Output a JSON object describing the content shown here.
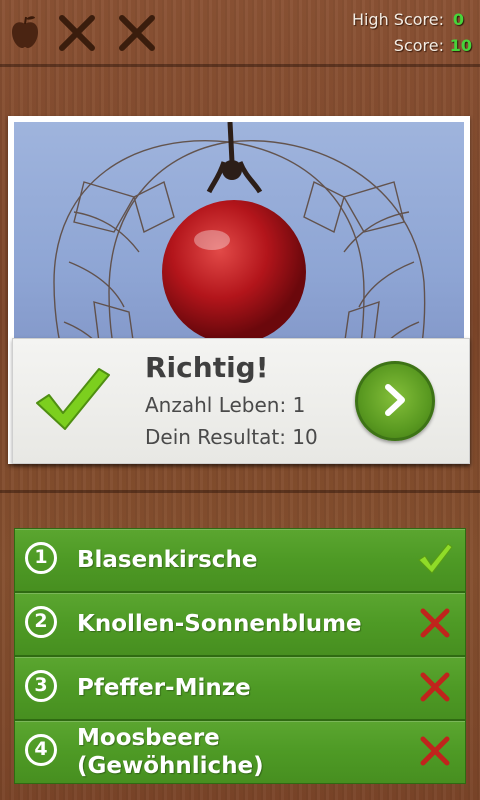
{
  "header": {
    "lives_icons": [
      "apple-icon",
      "x-icon",
      "x-icon"
    ],
    "high_score_label": "High Score:",
    "high_score_value": "0",
    "score_label": "Score:",
    "score_value": "10"
  },
  "photo": {
    "subject": "physalis-berry-image"
  },
  "result": {
    "title": "Richtig!",
    "lives_text": "Anzahl Leben: 1",
    "score_text": "Dein Resultat: 10",
    "status_icon": "check-icon",
    "next_icon": "chevron-right-icon"
  },
  "answers": [
    {
      "number": "1",
      "label": "Blasenkirsche",
      "status": "correct"
    },
    {
      "number": "2",
      "label": "Knollen-Sonnenblume",
      "status": "wrong"
    },
    {
      "number": "3",
      "label": "Pfeffer-Minze",
      "status": "wrong"
    },
    {
      "number": "4",
      "label": "Moosbeere (Gewöhnliche)",
      "status": "wrong"
    }
  ],
  "colors": {
    "accent_green": "#47d43a",
    "answer_green": "#4e9a25",
    "check_green": "#7ccf1e",
    "wrong_red": "#c0241c",
    "wood": "#7c4529"
  }
}
